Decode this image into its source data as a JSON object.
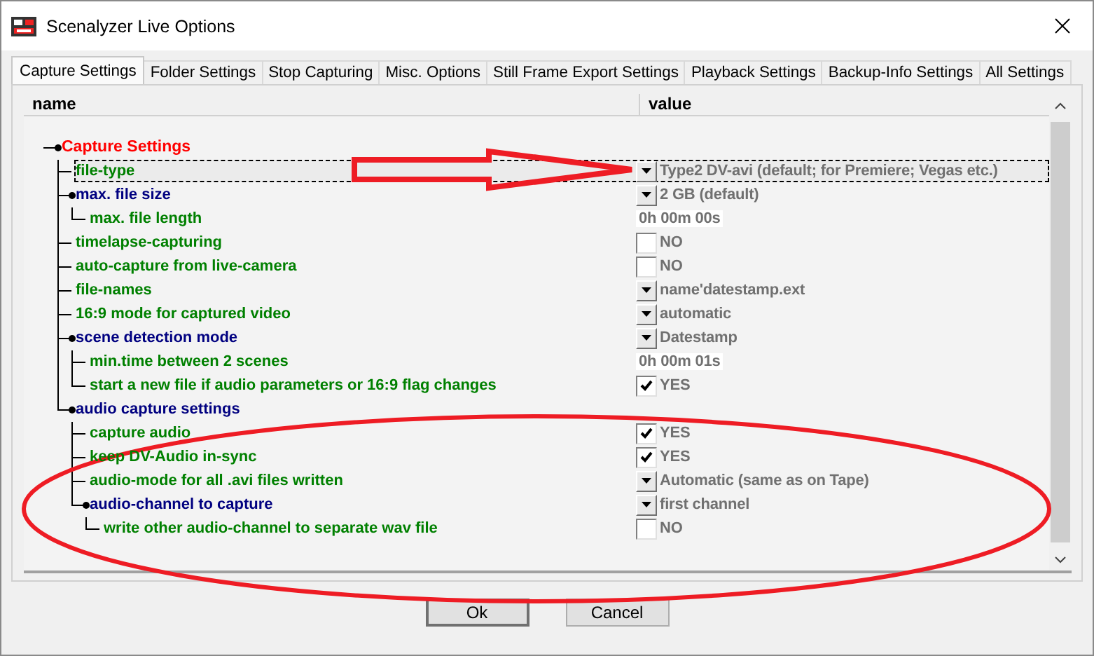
{
  "window": {
    "title": "Scenalyzer Live Options"
  },
  "tabs": [
    {
      "label": "Capture Settings",
      "selected": true
    },
    {
      "label": "Folder Settings",
      "selected": false
    },
    {
      "label": "Stop Capturing",
      "selected": false
    },
    {
      "label": "Misc. Options",
      "selected": false
    },
    {
      "label": "Still Frame Export Settings",
      "selected": false
    },
    {
      "label": "Playback Settings",
      "selected": false
    },
    {
      "label": "Backup-Info Settings",
      "selected": false
    },
    {
      "label": "All Settings",
      "selected": false
    }
  ],
  "columns": [
    "name",
    "value"
  ],
  "tree": [
    {
      "label": "Capture Settings",
      "selected": false,
      "children": [
        {
          "label": "file-type",
          "selected": true,
          "value": {
            "kind": "dropdown",
            "text": "Type2 DV-avi (default; for Premiere; Vegas etc.)"
          }
        },
        {
          "label": "max. file size",
          "selected": false,
          "value": {
            "kind": "dropdown",
            "text": "2 GB (default)"
          },
          "children": [
            {
              "label": "max. file length",
              "selected": false,
              "value": {
                "kind": "field",
                "text": "0h 00m 00s"
              }
            }
          ]
        },
        {
          "label": "timelapse-capturing",
          "selected": false,
          "value": {
            "kind": "checkbox",
            "checked": false,
            "text": "NO"
          }
        },
        {
          "label": "auto-capture from live-camera",
          "selected": false,
          "value": {
            "kind": "checkbox",
            "checked": false,
            "text": "NO"
          }
        },
        {
          "label": "file-names",
          "selected": false,
          "value": {
            "kind": "dropdown",
            "text": "name'datestamp.ext"
          }
        },
        {
          "label": "16:9 mode for captured video",
          "selected": false,
          "value": {
            "kind": "dropdown",
            "text": "automatic"
          }
        },
        {
          "label": "scene detection mode",
          "selected": false,
          "value": {
            "kind": "dropdown",
            "text": "Datestamp"
          },
          "children": [
            {
              "label": "min.time between 2 scenes",
              "selected": false,
              "value": {
                "kind": "field",
                "text": "0h 00m 01s"
              }
            },
            {
              "label": "start a new file if audio parameters or 16:9 flag changes",
              "selected": false,
              "value": {
                "kind": "checkbox",
                "checked": true,
                "text": "YES"
              }
            }
          ]
        },
        {
          "label": "audio capture settings",
          "selected": false,
          "children": [
            {
              "label": "capture audio",
              "selected": false,
              "value": {
                "kind": "checkbox",
                "checked": true,
                "text": "YES"
              }
            },
            {
              "label": "keep DV-Audio in-sync",
              "selected": false,
              "value": {
                "kind": "checkbox",
                "checked": true,
                "text": "YES"
              }
            },
            {
              "label": "audio-mode for all .avi files written",
              "selected": false,
              "value": {
                "kind": "dropdown",
                "text": "Automatic (same as on Tape)"
              }
            },
            {
              "label": "audio-channel to capture",
              "selected": false,
              "value": {
                "kind": "dropdown",
                "text": "first channel"
              },
              "children": [
                {
                  "label": "write other audio-channel to separate wav file",
                  "selected": false,
                  "value": {
                    "kind": "checkbox",
                    "checked": false,
                    "text": "NO"
                  }
                }
              ]
            }
          ]
        }
      ]
    }
  ],
  "buttons": [
    {
      "label": "Ok",
      "default": true
    },
    {
      "label": "Cancel",
      "default": false
    }
  ]
}
